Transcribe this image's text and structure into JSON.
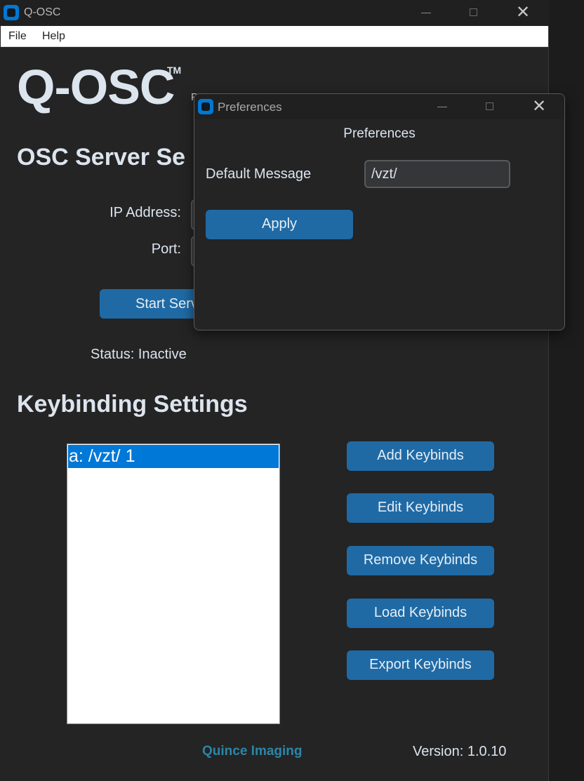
{
  "window": {
    "title": "Q-OSC",
    "close_glyph": "✕"
  },
  "menu": {
    "items": [
      "File",
      "Help"
    ]
  },
  "app": {
    "title": "Q-OSC",
    "trademark": "TM",
    "subtitle_partial": "Po"
  },
  "osc_section": {
    "heading": "OSC Server Se",
    "ip_label": "IP Address:",
    "port_label": "Port:",
    "start_button": "Start Serv",
    "status": "Status: Inactive"
  },
  "keybinding_section": {
    "heading": "Keybinding Settings",
    "list_items": [
      "a: /vzt/ 1"
    ],
    "buttons": {
      "add": "Add Keybinds",
      "edit": "Edit Keybinds",
      "remove": "Remove Keybinds",
      "load": "Load Keybinds",
      "export": "Export Keybinds"
    }
  },
  "footer": {
    "company": "Quince Imaging",
    "version": "Version: 1.0.10"
  },
  "preferences_dialog": {
    "window_title": "Preferences",
    "heading": "Preferences",
    "default_message_label": "Default Message",
    "default_message_value": "/vzt/",
    "apply_button": "Apply",
    "close_glyph": "✕"
  },
  "colors": {
    "background": "#242424",
    "accent_button": "#1f6aa5",
    "selection": "#0078d7",
    "company_text": "#2b86a8"
  },
  "icons": [
    "app-icon",
    "minimize-icon",
    "maximize-icon",
    "close-icon"
  ]
}
